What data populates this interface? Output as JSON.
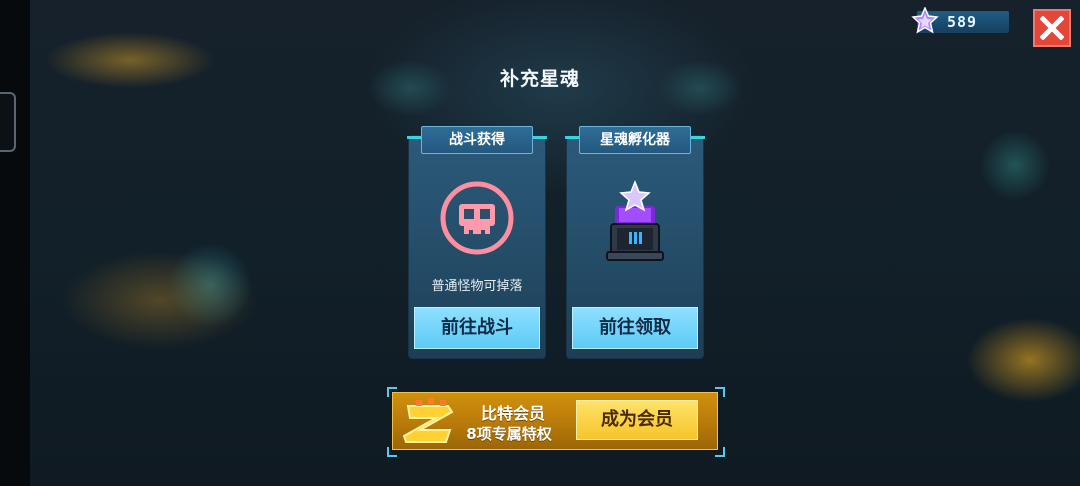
{
  "hud": {
    "currency_icon": "star-soul-gem-icon",
    "currency_value": "589",
    "close_icon": "close-x-icon",
    "accent_close": "#e3473a"
  },
  "dialog": {
    "title": "补充星魂",
    "cards": [
      {
        "header": "战斗获得",
        "icon": "pink-skull-icon",
        "description": "普通怪物可掉落",
        "button": "前往战斗"
      },
      {
        "header": "星魂孵化器",
        "icon": "star-soul-incubator-icon",
        "description": "",
        "button": "前往领取"
      }
    ],
    "vip": {
      "logo_icon": "bit-member-badge-icon",
      "title": "比特会员",
      "subtitle": "8项专属特权",
      "button": "成为会员"
    }
  },
  "colors": {
    "card_button": "#5ccaf5",
    "vip_gold": "#d0910e",
    "card_accent": "#36d6e0"
  }
}
